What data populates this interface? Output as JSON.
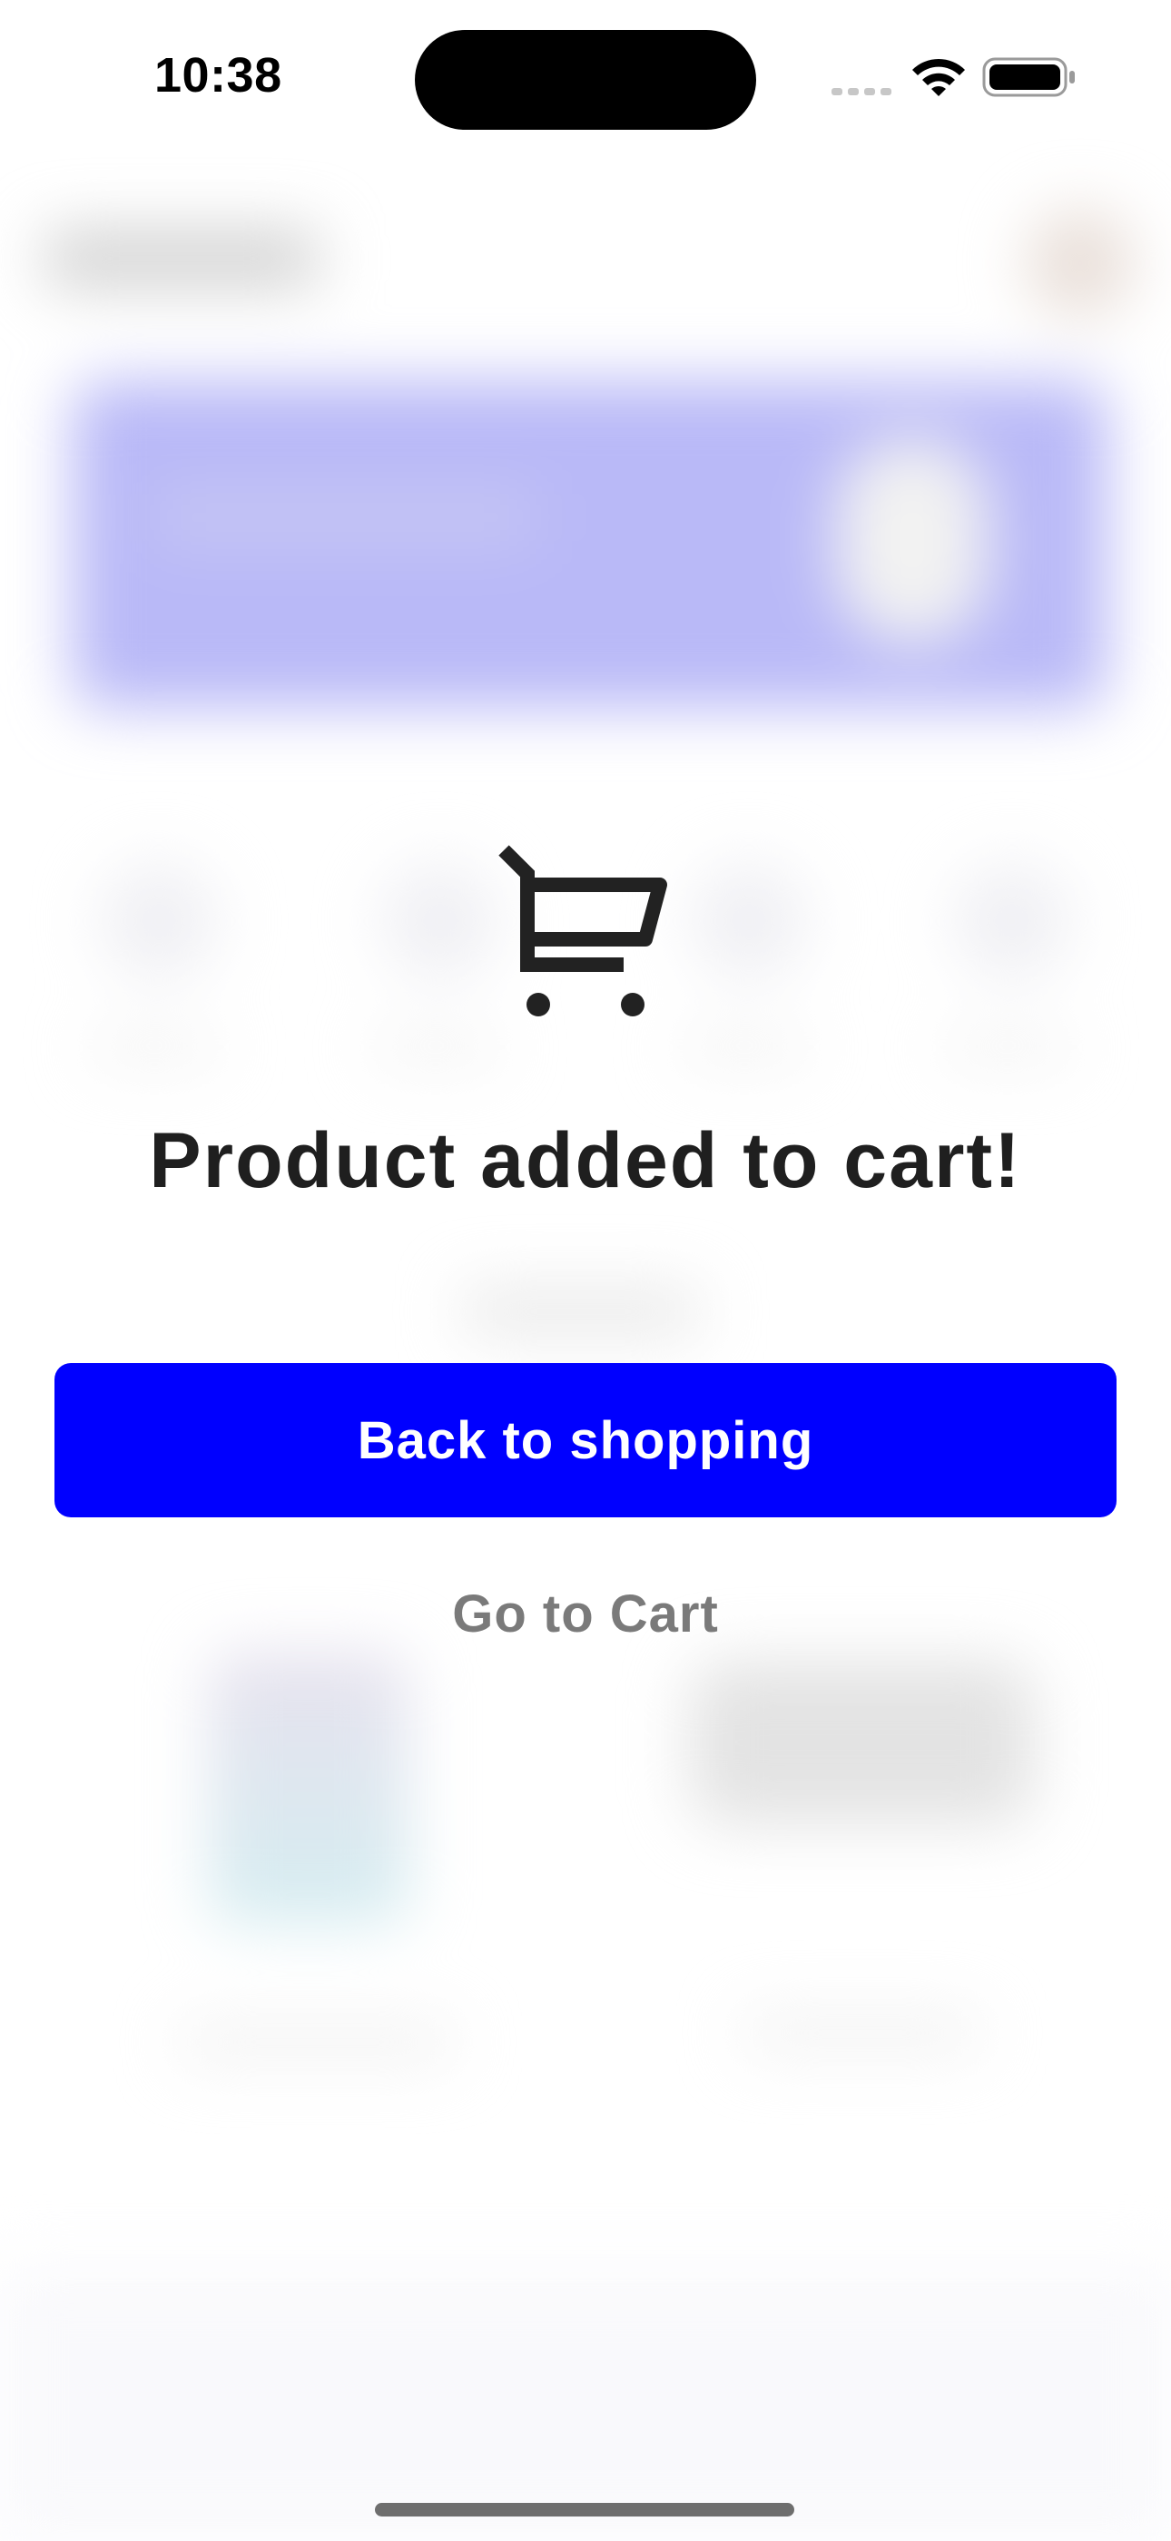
{
  "status_bar": {
    "time": "10:38",
    "icons": [
      "cellular-signal-icon",
      "wifi-icon",
      "battery-icon"
    ]
  },
  "modal": {
    "icon": "shopping-cart-icon",
    "title": "Product added to cart!",
    "primary_button_label": "Back to shopping",
    "secondary_link_label": "Go to Cart"
  },
  "colors": {
    "primary_button": "#0000FF",
    "title_text": "#1F1F1F",
    "secondary_text": "#7A7A7A",
    "background": "#FFFFFF",
    "blurred_banner": "#B9B9F7"
  }
}
